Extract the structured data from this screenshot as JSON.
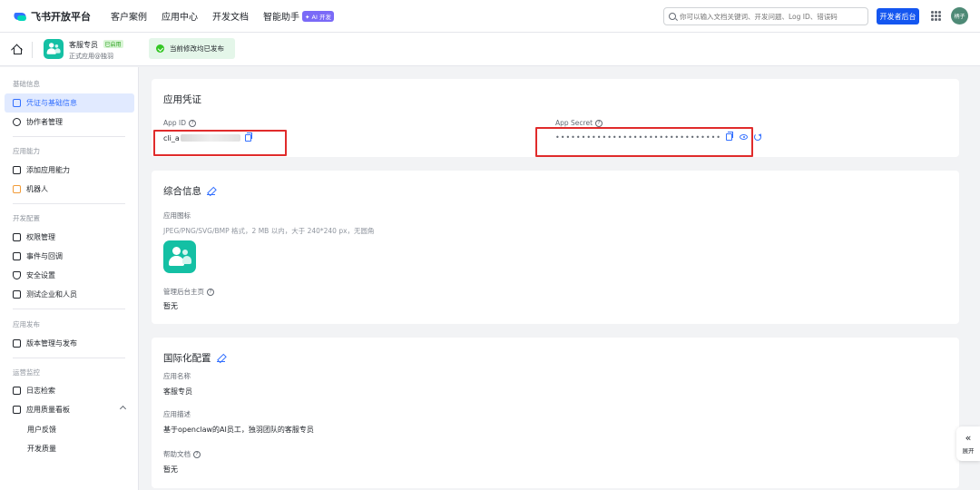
{
  "topbar": {
    "logo_text": "飞书开放平台",
    "nav": [
      {
        "label": "客户案例"
      },
      {
        "label": "应用中心"
      },
      {
        "label": "开发文档"
      },
      {
        "label": "智能助手",
        "badge": "✦ AI 开发"
      }
    ],
    "search_placeholder": "你可以输入文档关键词、开发问题、Log ID、错误码",
    "dev_button": "开发者后台",
    "avatar_text": "柄子"
  },
  "subbar": {
    "app_name": "客服专员",
    "app_status": "已启用",
    "app_subtitle": "正式应用@独羽",
    "publish_notice": "当前修改均已发布"
  },
  "sidebar": {
    "sections": [
      {
        "title": "基础信息",
        "items": [
          {
            "label": "凭证与基础信息",
            "icon": "credential-icon",
            "active": true
          },
          {
            "label": "协作者管理",
            "icon": "user-icon"
          }
        ]
      },
      {
        "title": "应用能力",
        "items": [
          {
            "label": "添加应用能力",
            "icon": "grid-add-icon"
          },
          {
            "label": "机器人",
            "icon": "robot-icon"
          }
        ]
      },
      {
        "title": "开发配置",
        "items": [
          {
            "label": "权限管理",
            "icon": "lock-icon"
          },
          {
            "label": "事件与回调",
            "icon": "event-icon"
          },
          {
            "label": "安全设置",
            "icon": "shield-icon"
          },
          {
            "label": "测试企业和人员",
            "icon": "test-icon"
          }
        ]
      },
      {
        "title": "应用发布",
        "items": [
          {
            "label": "版本管理与发布",
            "icon": "upload-icon"
          }
        ]
      },
      {
        "title": "运营监控",
        "items": [
          {
            "label": "日志检索",
            "icon": "log-icon"
          },
          {
            "label": "应用质量看板",
            "icon": "chart-icon"
          },
          {
            "label": "用户反馈",
            "icon": "",
            "sub": true
          },
          {
            "label": "开发质量",
            "icon": "",
            "sub": true
          }
        ]
      }
    ]
  },
  "credentials": {
    "title": "应用凭证",
    "app_id_label": "App ID",
    "app_id_value": "cli_a",
    "app_secret_label": "App Secret",
    "app_secret_value": "••••••••••••••••••••••••••••••••"
  },
  "general": {
    "title": "综合信息",
    "icon_label": "应用图标",
    "icon_hint": "JPEG/PNG/SVG/BMP 格式，2 MB 以内，大于 240*240 px，无圆角",
    "admin_home_label": "管理后台主页",
    "admin_home_value": "暂无"
  },
  "i18n": {
    "title": "国际化配置",
    "name_label": "应用名称",
    "name_value": "客服专员",
    "desc_label": "应用描述",
    "desc_value": "基于openclaw的AI员工，独羽团队的客服专员",
    "help_label": "帮助文档",
    "help_value": "暂无"
  },
  "expand_label": "展开",
  "colors": {
    "accent": "#3370ff",
    "brand_teal": "#14c0a4",
    "highlight_box": "#e02b2b"
  }
}
